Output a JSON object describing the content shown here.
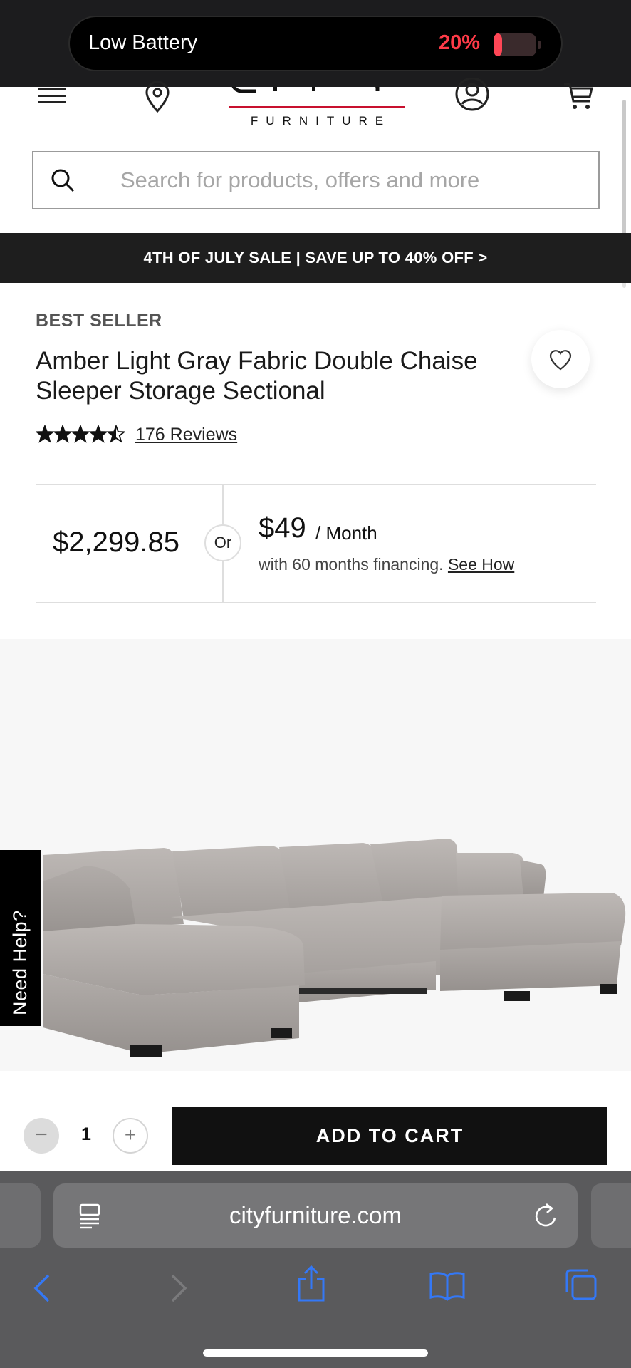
{
  "status": {
    "battery_label": "Low Battery",
    "battery_percent": "20%",
    "battery_level": 0.2,
    "battery_color": "#ff3b48"
  },
  "header": {
    "menu_icon": "hamburger-menu-icon",
    "store_icon": "location-pin-icon",
    "logo_text": "CITY",
    "logo_subtext": "FURNITURE",
    "account_icon": "user-account-icon",
    "cart_icon": "shopping-cart-icon"
  },
  "search": {
    "placeholder": "Search for products, offers and more",
    "icon": "search-icon"
  },
  "promo": {
    "text": "4TH OF JULY SALE | SAVE UP TO 40% OFF >"
  },
  "product": {
    "badge": "BEST SELLER",
    "title": "Amber Light Gray Fabric Double Chaise Sleeper Storage Sectional",
    "rating": 4.5,
    "rating_max": 5,
    "reviews_label": "176 Reviews",
    "favorite_icon": "heart-icon"
  },
  "pricing": {
    "price": "$2,299.85",
    "or_label": "Or",
    "monthly_amount": "$49",
    "monthly_unit": "/ Month",
    "financing_text": "with 60 months financing.",
    "see_how_label": "See How"
  },
  "help": {
    "label": "Need Help?"
  },
  "cart": {
    "minus_label": "−",
    "quantity": "1",
    "plus_label": "+",
    "add_label": "ADD TO CART"
  },
  "browser": {
    "url": "cityfurniture.com",
    "reader_icon": "reader-mode-icon",
    "reload_icon": "reload-icon",
    "nav": {
      "back_icon": "back-arrow-icon",
      "forward_icon": "forward-arrow-icon",
      "share_icon": "share-icon",
      "bookmarks_icon": "bookmarks-icon",
      "tabs_icon": "tabs-icon"
    },
    "accent_color": "#3478f6"
  }
}
